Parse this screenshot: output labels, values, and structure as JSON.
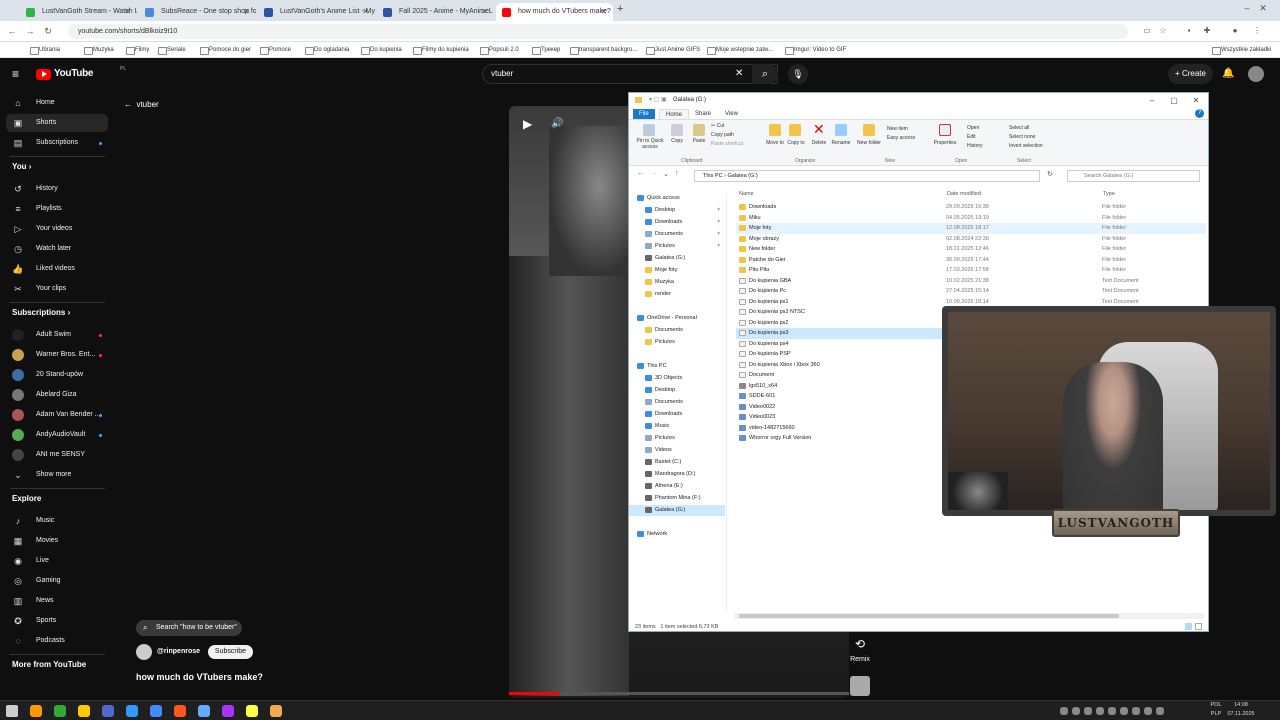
{
  "browser": {
    "tabs": [
      {
        "label": "LustVanGoth Stream - Watch L",
        "color": "#2fb34a"
      },
      {
        "label": "SubsReace - One stop shop fo",
        "color": "#4b89dc"
      },
      {
        "label": "LustVanGoth's Anime List - My",
        "color": "#2e51a2"
      },
      {
        "label": "Fall 2025 - Anime - MyAnimeL",
        "color": "#2e51a2"
      },
      {
        "label": "how much do VTubers make?",
        "color": "#ff0000"
      }
    ],
    "new_tab": "+",
    "url": "youtube.com/shorts/dBlkoiz9t10",
    "bookmarks": [
      "Ubrania",
      "Muzyka",
      "Filmy",
      "Seriale",
      "Pomoce do gier",
      "Pomoce",
      "Do ogladania",
      "Do kupienia",
      "Filmy do kupienia",
      "Popsuli 2.0",
      "Трекер",
      "transparent backgro...",
      "Just Anime GIFS",
      "Moje wstepnie zatw...",
      "Imgur: Video to GIF"
    ],
    "bookmarks_right": "Wszystkie zakładki"
  },
  "youtube": {
    "logo": "YouTube",
    "logo_suffix": "PL",
    "search_value": "vtuber",
    "clear": "✕",
    "create": "Create",
    "back_label": "vtuber",
    "sidebar": {
      "main": [
        {
          "label": "Home",
          "icon": "home-icon",
          "glyph": "⌂"
        },
        {
          "label": "Shorts",
          "icon": "shorts-icon",
          "glyph": "▣"
        },
        {
          "label": "Subscriptions",
          "icon": "subscriptions-icon",
          "glyph": "▤"
        }
      ],
      "you_header": "You",
      "you": [
        {
          "label": "History",
          "icon": "history-icon",
          "glyph": "↺"
        },
        {
          "label": "Playlists",
          "icon": "playlists-icon",
          "glyph": "≡"
        },
        {
          "label": "Your videos",
          "icon": "your-videos-icon",
          "glyph": "▷"
        },
        {
          "label": "Watch later",
          "icon": "watch-later-icon",
          "glyph": "◷"
        },
        {
          "label": "Liked videos",
          "icon": "liked-videos-icon",
          "glyph": "👍"
        },
        {
          "label": "Your clips",
          "icon": "clips-icon",
          "glyph": "✂"
        }
      ],
      "subs_header": "Subscriptions",
      "subs": [
        {
          "label": "Adult Swim",
          "color": "#222"
        },
        {
          "label": "Warner Bros. Ent...",
          "color": "#c8a24a"
        },
        {
          "label": "20 Stand-upów",
          "color": "#3a6ea5"
        },
        {
          "label": "Abelard Giza",
          "color": "#777"
        },
        {
          "label": "Adam Van Bender ...",
          "color": "#a55"
        },
        {
          "label": "AndyAudioVault",
          "color": "#5a5"
        },
        {
          "label": "ANI me SENSY",
          "color": "#444"
        }
      ],
      "show_more": "Show more",
      "explore_header": "Explore",
      "explore": [
        {
          "label": "Music",
          "icon": "music-icon",
          "glyph": "♪"
        },
        {
          "label": "Movies",
          "icon": "movies-icon",
          "glyph": "▦"
        },
        {
          "label": "Live",
          "icon": "live-icon",
          "glyph": "◉"
        },
        {
          "label": "Gaming",
          "icon": "gaming-icon",
          "glyph": "◎"
        },
        {
          "label": "News",
          "icon": "news-icon",
          "glyph": "▥"
        },
        {
          "label": "Sports",
          "icon": "sports-icon",
          "glyph": "✪"
        },
        {
          "label": "Podcasts",
          "icon": "podcasts-icon",
          "glyph": "◌"
        }
      ],
      "more_header": "More from YouTube"
    },
    "short": {
      "search_pill": "Search \"how to be vtuber\"",
      "channel": "@rinpenrose",
      "subscribe": "Subscribe",
      "title": "how much do VTubers make?",
      "remix": "Remix",
      "progress": 0.15
    }
  },
  "explorer": {
    "title": "Galatea (G:)",
    "ribbon_tabs": [
      "File",
      "Home",
      "Share",
      "View"
    ],
    "ribbon": {
      "pin": "Pin to Quick access",
      "copy": "Copy",
      "paste": "Paste",
      "cut": "Cut",
      "copy_path": "Copy path",
      "paste_shortcut": "Paste shortcut",
      "move_to": "Move to",
      "copy_to": "Copy to",
      "delete": "Delete",
      "rename": "Rename",
      "new_folder": "New folder",
      "new_item": "New item",
      "easy_access": "Easy access",
      "properties": "Properties",
      "open": "Open",
      "edit": "Edit",
      "history": "History",
      "select_all": "Select all",
      "select_none": "Select none",
      "invert": "Invert selection",
      "groups": [
        "Clipboard",
        "Organize",
        "New",
        "Open",
        "Select"
      ]
    },
    "address": "This PC  ›  Galatea (G:)",
    "search_placeholder": "Search Galatea (G:)",
    "columns": [
      "Name",
      "Date modified",
      "Type"
    ],
    "nav": [
      {
        "label": "Quick access",
        "indent": 0,
        "color": "#3a8ee6"
      },
      {
        "label": "Desktop",
        "indent": 1,
        "color": "#3a8ee6"
      },
      {
        "label": "Downloads",
        "indent": 1,
        "color": "#3a8ee6"
      },
      {
        "label": "Documents",
        "indent": 1,
        "color": "#8ea9c9"
      },
      {
        "label": "Pictures",
        "indent": 1,
        "color": "#8ea9c9"
      },
      {
        "label": "Galatea (G:)",
        "indent": 1,
        "color": "#666"
      },
      {
        "label": "Moje foty",
        "indent": 1,
        "color": "#f0c54a"
      },
      {
        "label": "Muzyka",
        "indent": 1,
        "color": "#f0c54a"
      },
      {
        "label": "render",
        "indent": 1,
        "color": "#f0c54a"
      },
      {
        "label": "",
        "indent": 0,
        "color": ""
      },
      {
        "label": "OneDrive - Personal",
        "indent": 0,
        "color": "#3a8ee6"
      },
      {
        "label": "Documents",
        "indent": 1,
        "color": "#f0c54a"
      },
      {
        "label": "Pictures",
        "indent": 1,
        "color": "#f0c54a"
      },
      {
        "label": "",
        "indent": 0,
        "color": ""
      },
      {
        "label": "This PC",
        "indent": 0,
        "color": "#3a8ee6"
      },
      {
        "label": "3D Objects",
        "indent": 1,
        "color": "#3a8ee6"
      },
      {
        "label": "Desktop",
        "indent": 1,
        "color": "#3a8ee6"
      },
      {
        "label": "Documents",
        "indent": 1,
        "color": "#8ea9c9"
      },
      {
        "label": "Downloads",
        "indent": 1,
        "color": "#3a8ee6"
      },
      {
        "label": "Music",
        "indent": 1,
        "color": "#3a8ee6"
      },
      {
        "label": "Pictures",
        "indent": 1,
        "color": "#8ea9c9"
      },
      {
        "label": "Videos",
        "indent": 1,
        "color": "#8ea9c9"
      },
      {
        "label": "Bastet (C:)",
        "indent": 1,
        "color": "#666"
      },
      {
        "label": "Mandragora (D:)",
        "indent": 1,
        "color": "#666"
      },
      {
        "label": "Athena (E:)",
        "indent": 1,
        "color": "#666"
      },
      {
        "label": "Phantom Mina (F:)",
        "indent": 1,
        "color": "#666"
      },
      {
        "label": "Galatea (G:)",
        "indent": 1,
        "color": "#666"
      },
      {
        "label": "",
        "indent": 0,
        "color": ""
      },
      {
        "label": "Network",
        "indent": 0,
        "color": "#3a8ee6"
      }
    ],
    "nav_selected": 26,
    "files": [
      {
        "name": "Downloads",
        "date": "29.09.2025 16:38",
        "type": "File folder",
        "kind": "folder"
      },
      {
        "name": "Miku",
        "date": "04.05.2025 19:19",
        "type": "File folder",
        "kind": "folder"
      },
      {
        "name": "Moje foty",
        "date": "12.08.2025 18:17",
        "type": "File folder",
        "kind": "folder"
      },
      {
        "name": "Moje obrazy",
        "date": "02.08.2024 22:30",
        "type": "File folder",
        "kind": "folder"
      },
      {
        "name": "New folder",
        "date": "18.01.2025 12:46",
        "type": "File folder",
        "kind": "folder"
      },
      {
        "name": "Patche do Gier",
        "date": "30.09.2025 17:44",
        "type": "File folder",
        "kind": "folder"
      },
      {
        "name": "Pitu Pitu",
        "date": "17.03.2025 17:58",
        "type": "File folder",
        "kind": "folder"
      },
      {
        "name": "Do kupienia GBA",
        "date": "10.02.2025 21:38",
        "type": "Text Document",
        "kind": "doc"
      },
      {
        "name": "Do kupienia Pc",
        "date": "27.04.2025 15:14",
        "type": "Text Document",
        "kind": "doc"
      },
      {
        "name": "Do kupienia ps1",
        "date": "10.09.2025 18:14",
        "type": "Text Document",
        "kind": "doc"
      },
      {
        "name": "Do kupienia ps2 NTSC",
        "date": "",
        "type": "Text Document",
        "kind": "doc"
      },
      {
        "name": "Do kupienia ps2",
        "date": "",
        "type": "",
        "kind": "doc"
      },
      {
        "name": "Do kupienia ps3",
        "date": "",
        "type": "",
        "kind": "doc"
      },
      {
        "name": "Do kupienia ps4",
        "date": "",
        "type": "",
        "kind": "doc"
      },
      {
        "name": "Do kupienia PSP",
        "date": "",
        "type": "",
        "kind": "doc"
      },
      {
        "name": "Do kupienia Xbox i Xbox 360",
        "date": "",
        "type": "",
        "kind": "doc"
      },
      {
        "name": "Document",
        "date": "",
        "type": "",
        "kind": "doc"
      },
      {
        "name": "lgs510_x64",
        "date": "",
        "type": "",
        "kind": "app"
      },
      {
        "name": "SDDE-601",
        "date": "",
        "type": "",
        "kind": "vid"
      },
      {
        "name": "Video0022",
        "date": "",
        "type": "",
        "kind": "vid"
      },
      {
        "name": "Video0023",
        "date": "",
        "type": "",
        "kind": "vid"
      },
      {
        "name": "video-1482715660",
        "date": "",
        "type": "",
        "kind": "vid"
      },
      {
        "name": "Whorror orgy Full Version",
        "date": "",
        "type": "",
        "kind": "vid"
      }
    ],
    "hover_index": 2,
    "selected_index": 12,
    "status_items": "23 items",
    "status_selected": "1 item selected  6,73 KB"
  },
  "stream": {
    "logo_text": "LUSTVANGOTH"
  },
  "taskbar": {
    "time": "14:08",
    "date": "07.11.2025",
    "lang1": "POL",
    "lang2": "PLP"
  },
  "colors": {
    "yt_red": "#ff0000",
    "folder": "#f0c54a",
    "select_blue": "#cce8ff"
  }
}
